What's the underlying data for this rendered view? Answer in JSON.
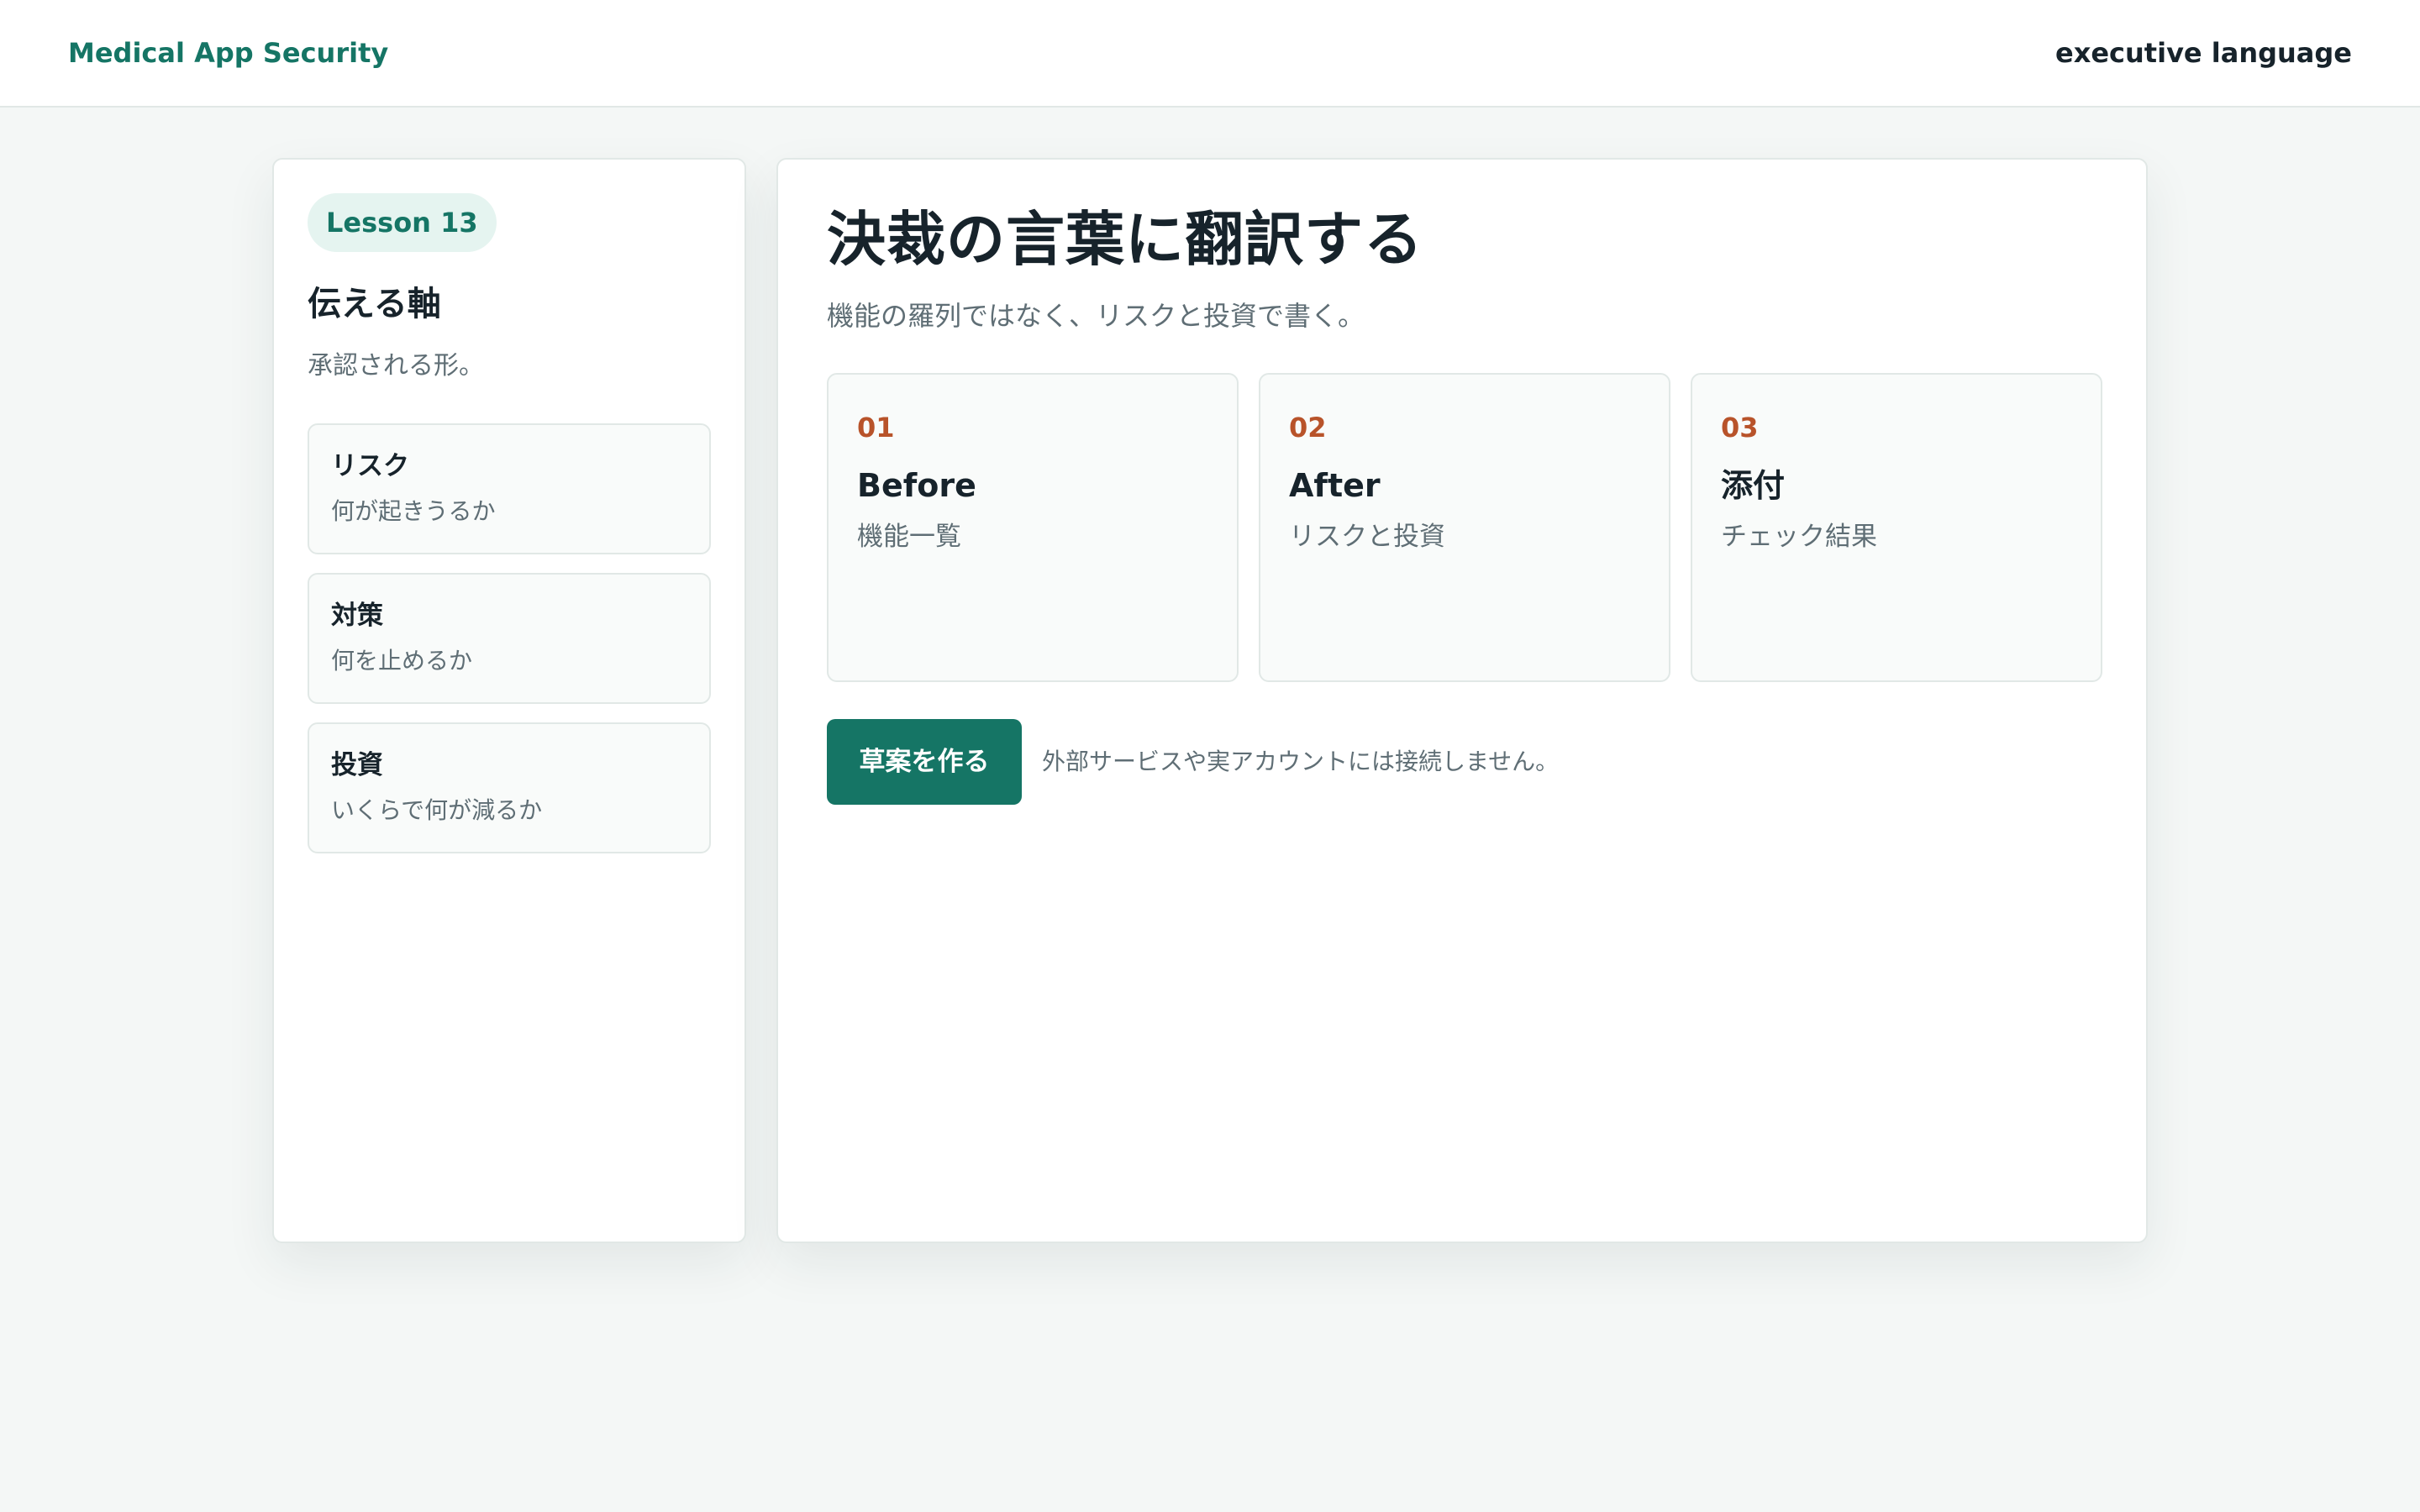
{
  "header": {
    "brand": "Medical App Security",
    "topic": "executive language"
  },
  "sidebar": {
    "lesson_badge": "Lesson 13",
    "title": "伝える軸",
    "subtitle": "承認される形。",
    "items": [
      {
        "title": "リスク",
        "desc": "何が起きうるか"
      },
      {
        "title": "対策",
        "desc": "何を止めるか"
      },
      {
        "title": "投資",
        "desc": "いくらで何が減るか"
      }
    ]
  },
  "main": {
    "title": "決裁の言葉に翻訳する",
    "subtitle": "機能の羅列ではなく、リスクと投資で書く。",
    "steps": [
      {
        "number": "01",
        "title": "Before",
        "desc": "機能一覧"
      },
      {
        "number": "02",
        "title": "After",
        "desc": "リスクと投資"
      },
      {
        "number": "03",
        "title": "添付",
        "desc": "チェック結果"
      }
    ],
    "primary_button": "草案を作る",
    "note": "外部サービスや実アカウントには接続しません。"
  },
  "colors": {
    "accent": "#157565",
    "accent_soft": "#e5f4f0",
    "step_number": "#b8532a",
    "background": "#f4f7f6",
    "text": "#17232b",
    "muted": "#5f6e75"
  }
}
